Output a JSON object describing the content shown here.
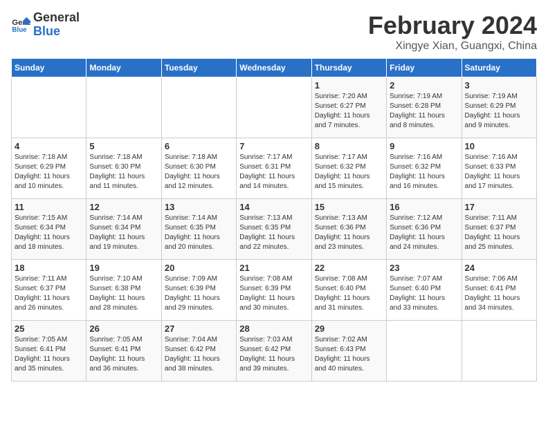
{
  "logo": {
    "general": "General",
    "blue": "Blue"
  },
  "title": "February 2024",
  "subtitle": "Xingye Xian, Guangxi, China",
  "days_of_week": [
    "Sunday",
    "Monday",
    "Tuesday",
    "Wednesday",
    "Thursday",
    "Friday",
    "Saturday"
  ],
  "weeks": [
    [
      {
        "day": "",
        "info": ""
      },
      {
        "day": "",
        "info": ""
      },
      {
        "day": "",
        "info": ""
      },
      {
        "day": "",
        "info": ""
      },
      {
        "day": "1",
        "info": "Sunrise: 7:20 AM\nSunset: 6:27 PM\nDaylight: 11 hours\nand 7 minutes."
      },
      {
        "day": "2",
        "info": "Sunrise: 7:19 AM\nSunset: 6:28 PM\nDaylight: 11 hours\nand 8 minutes."
      },
      {
        "day": "3",
        "info": "Sunrise: 7:19 AM\nSunset: 6:29 PM\nDaylight: 11 hours\nand 9 minutes."
      }
    ],
    [
      {
        "day": "4",
        "info": "Sunrise: 7:18 AM\nSunset: 6:29 PM\nDaylight: 11 hours\nand 10 minutes."
      },
      {
        "day": "5",
        "info": "Sunrise: 7:18 AM\nSunset: 6:30 PM\nDaylight: 11 hours\nand 11 minutes."
      },
      {
        "day": "6",
        "info": "Sunrise: 7:18 AM\nSunset: 6:30 PM\nDaylight: 11 hours\nand 12 minutes."
      },
      {
        "day": "7",
        "info": "Sunrise: 7:17 AM\nSunset: 6:31 PM\nDaylight: 11 hours\nand 14 minutes."
      },
      {
        "day": "8",
        "info": "Sunrise: 7:17 AM\nSunset: 6:32 PM\nDaylight: 11 hours\nand 15 minutes."
      },
      {
        "day": "9",
        "info": "Sunrise: 7:16 AM\nSunset: 6:32 PM\nDaylight: 11 hours\nand 16 minutes."
      },
      {
        "day": "10",
        "info": "Sunrise: 7:16 AM\nSunset: 6:33 PM\nDaylight: 11 hours\nand 17 minutes."
      }
    ],
    [
      {
        "day": "11",
        "info": "Sunrise: 7:15 AM\nSunset: 6:34 PM\nDaylight: 11 hours\nand 18 minutes."
      },
      {
        "day": "12",
        "info": "Sunrise: 7:14 AM\nSunset: 6:34 PM\nDaylight: 11 hours\nand 19 minutes."
      },
      {
        "day": "13",
        "info": "Sunrise: 7:14 AM\nSunset: 6:35 PM\nDaylight: 11 hours\nand 20 minutes."
      },
      {
        "day": "14",
        "info": "Sunrise: 7:13 AM\nSunset: 6:35 PM\nDaylight: 11 hours\nand 22 minutes."
      },
      {
        "day": "15",
        "info": "Sunrise: 7:13 AM\nSunset: 6:36 PM\nDaylight: 11 hours\nand 23 minutes."
      },
      {
        "day": "16",
        "info": "Sunrise: 7:12 AM\nSunset: 6:36 PM\nDaylight: 11 hours\nand 24 minutes."
      },
      {
        "day": "17",
        "info": "Sunrise: 7:11 AM\nSunset: 6:37 PM\nDaylight: 11 hours\nand 25 minutes."
      }
    ],
    [
      {
        "day": "18",
        "info": "Sunrise: 7:11 AM\nSunset: 6:37 PM\nDaylight: 11 hours\nand 26 minutes."
      },
      {
        "day": "19",
        "info": "Sunrise: 7:10 AM\nSunset: 6:38 PM\nDaylight: 11 hours\nand 28 minutes."
      },
      {
        "day": "20",
        "info": "Sunrise: 7:09 AM\nSunset: 6:39 PM\nDaylight: 11 hours\nand 29 minutes."
      },
      {
        "day": "21",
        "info": "Sunrise: 7:08 AM\nSunset: 6:39 PM\nDaylight: 11 hours\nand 30 minutes."
      },
      {
        "day": "22",
        "info": "Sunrise: 7:08 AM\nSunset: 6:40 PM\nDaylight: 11 hours\nand 31 minutes."
      },
      {
        "day": "23",
        "info": "Sunrise: 7:07 AM\nSunset: 6:40 PM\nDaylight: 11 hours\nand 33 minutes."
      },
      {
        "day": "24",
        "info": "Sunrise: 7:06 AM\nSunset: 6:41 PM\nDaylight: 11 hours\nand 34 minutes."
      }
    ],
    [
      {
        "day": "25",
        "info": "Sunrise: 7:05 AM\nSunset: 6:41 PM\nDaylight: 11 hours\nand 35 minutes."
      },
      {
        "day": "26",
        "info": "Sunrise: 7:05 AM\nSunset: 6:41 PM\nDaylight: 11 hours\nand 36 minutes."
      },
      {
        "day": "27",
        "info": "Sunrise: 7:04 AM\nSunset: 6:42 PM\nDaylight: 11 hours\nand 38 minutes."
      },
      {
        "day": "28",
        "info": "Sunrise: 7:03 AM\nSunset: 6:42 PM\nDaylight: 11 hours\nand 39 minutes."
      },
      {
        "day": "29",
        "info": "Sunrise: 7:02 AM\nSunset: 6:43 PM\nDaylight: 11 hours\nand 40 minutes."
      },
      {
        "day": "",
        "info": ""
      },
      {
        "day": "",
        "info": ""
      }
    ]
  ]
}
